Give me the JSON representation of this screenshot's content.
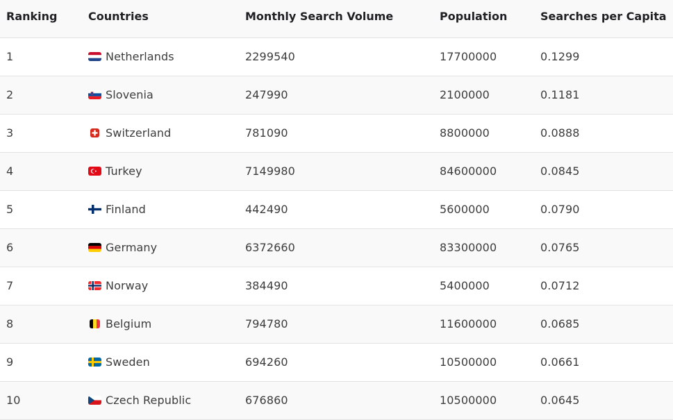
{
  "table": {
    "headers": {
      "ranking": "Ranking",
      "countries": "Countries",
      "monthly_search_volume": "Monthly Search Volume",
      "population": "Population",
      "searches_per_capita": "Searches per Capita"
    },
    "rows": [
      {
        "ranking": "1",
        "country": "Netherlands",
        "flag": "netherlands-flag-icon",
        "monthly_search_volume": "2299540",
        "population": "17700000",
        "searches_per_capita": "0.1299"
      },
      {
        "ranking": "2",
        "country": "Slovenia",
        "flag": "slovenia-flag-icon",
        "monthly_search_volume": "247990",
        "population": "2100000",
        "searches_per_capita": "0.1181"
      },
      {
        "ranking": "3",
        "country": "Switzerland",
        "flag": "switzerland-flag-icon",
        "monthly_search_volume": "781090",
        "population": "8800000",
        "searches_per_capita": "0.0888"
      },
      {
        "ranking": "4",
        "country": "Turkey",
        "flag": "turkey-flag-icon",
        "monthly_search_volume": "7149980",
        "population": "84600000",
        "searches_per_capita": "0.0845"
      },
      {
        "ranking": "5",
        "country": "Finland",
        "flag": "finland-flag-icon",
        "monthly_search_volume": "442490",
        "population": "5600000",
        "searches_per_capita": "0.0790"
      },
      {
        "ranking": "6",
        "country": "Germany",
        "flag": "germany-flag-icon",
        "monthly_search_volume": "6372660",
        "population": "83300000",
        "searches_per_capita": "0.0765"
      },
      {
        "ranking": "7",
        "country": "Norway",
        "flag": "norway-flag-icon",
        "monthly_search_volume": "384490",
        "population": "5400000",
        "searches_per_capita": "0.0712"
      },
      {
        "ranking": "8",
        "country": "Belgium",
        "flag": "belgium-flag-icon",
        "monthly_search_volume": "794780",
        "population": "11600000",
        "searches_per_capita": "0.0685"
      },
      {
        "ranking": "9",
        "country": "Sweden",
        "flag": "sweden-flag-icon",
        "monthly_search_volume": "694260",
        "population": "10500000",
        "searches_per_capita": "0.0661"
      },
      {
        "ranking": "10",
        "country": "Czech Republic",
        "flag": "czech-republic-flag-icon",
        "monthly_search_volume": "676860",
        "population": "10500000",
        "searches_per_capita": "0.0645"
      }
    ]
  },
  "colors": {
    "header_bg": "#f9f9f9",
    "row_alt_bg": "#f9f9f9",
    "border": "#e2e2e2",
    "header_text": "#1f1f24",
    "cell_text": "#3c3c3c"
  }
}
